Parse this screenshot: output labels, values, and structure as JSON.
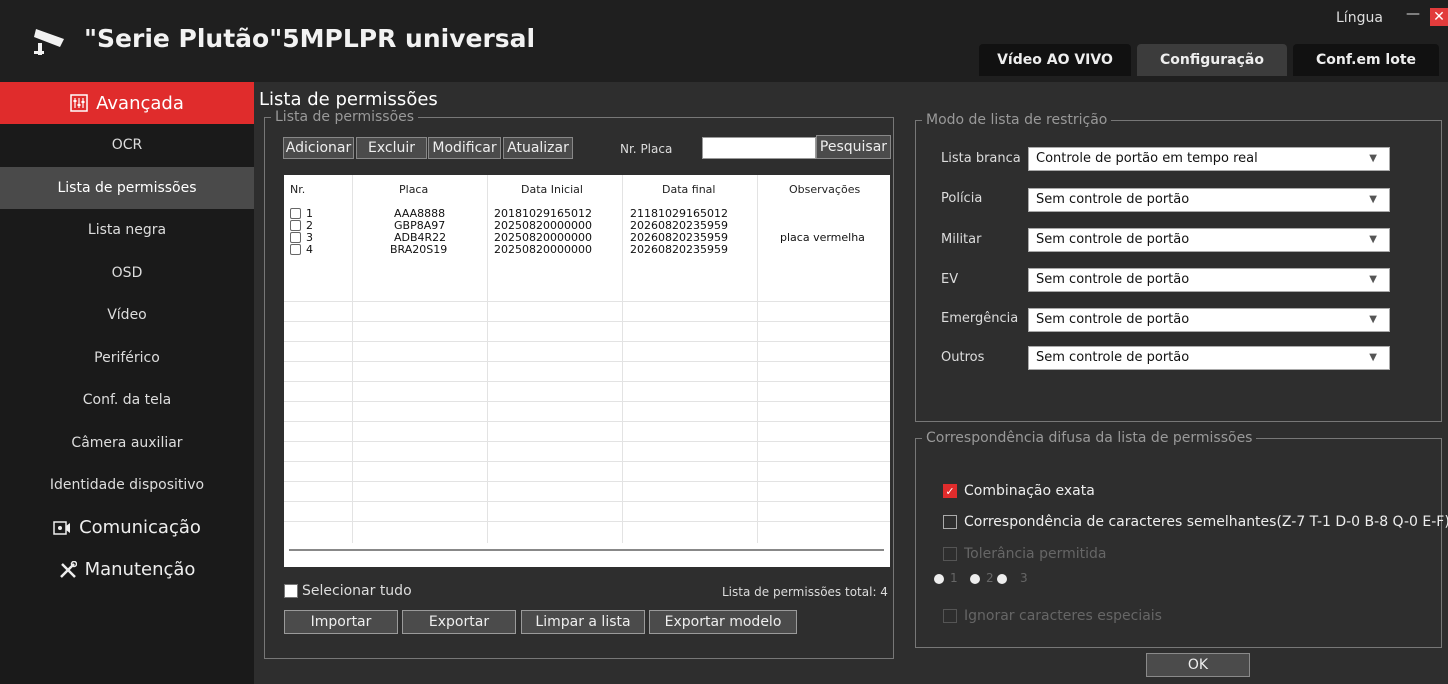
{
  "app": {
    "title": "\"Serie Plutão\"5MPLPR universal",
    "language_label": "Língua",
    "minimize": "—",
    "close": "✕"
  },
  "tabs": [
    "Vídeo AO VIVO",
    "Configuração",
    "Conf.em lote"
  ],
  "sidebar": {
    "header": "Avançada",
    "items": [
      "OCR",
      "Lista de permissões",
      "Lista negra",
      "OSD",
      "Vídeo",
      "Periférico",
      "Conf. da tela",
      "Câmera auxiliar",
      "Identidade dispositivo"
    ],
    "sections": [
      "Comunicação",
      "Manutenção"
    ]
  },
  "main": {
    "page_title": "Lista de permissões",
    "list_group": "Lista de permissões",
    "toolbar": {
      "add": "Adicionar",
      "delete": "Excluir",
      "modify": "Modificar",
      "refresh": "Atualizar",
      "plate_label": "Nr. Placa",
      "plate_value": "",
      "search": "Pesquisar"
    },
    "table": {
      "headers": [
        "Nr.",
        "Placa",
        "Data Inicial",
        "Data final",
        "Observações"
      ],
      "rows": [
        {
          "nr": "1",
          "placa": "AAA8888",
          "inicial": "20181029165012",
          "final": "21181029165012",
          "obs": ""
        },
        {
          "nr": "2",
          "placa": "GBP8A97",
          "inicial": "20250820000000",
          "final": "20260820235959",
          "obs": ""
        },
        {
          "nr": "3",
          "placa": "ADB4R22",
          "inicial": "20250820000000",
          "final": "20260820235959",
          "obs": "placa vermelha"
        },
        {
          "nr": "4",
          "placa": "BRA20S19",
          "inicial": "20250820000000",
          "final": "20260820235959",
          "obs": ""
        }
      ]
    },
    "select_all": "Selecionar tudo",
    "total": "Lista de permissões total: 4",
    "bottom_buttons": {
      "import": "Importar",
      "export": "Exportar",
      "clear": "Limpar a lista",
      "export_template": "Exportar modelo"
    }
  },
  "restriction": {
    "legend": "Modo de lista de restrição",
    "rows": [
      {
        "label": "Lista branca",
        "value": "Controle de portão em tempo real"
      },
      {
        "label": "Polícia",
        "value": "Sem controle de portão"
      },
      {
        "label": "Militar",
        "value": "Sem controle de portão"
      },
      {
        "label": "EV",
        "value": "Sem controle de portão"
      },
      {
        "label": "Emergência",
        "value": "Sem controle de portão"
      },
      {
        "label": "Outros",
        "value": "Sem controle de portão"
      }
    ]
  },
  "fuzzy": {
    "legend": "Correspondência difusa da lista de permissões",
    "exact": "Combinação exata",
    "similar": "Correspondência de caracteres semelhantes(Z-7 T-1 D-0 B-8 Q-0 E-F)",
    "tolerance": "Tolerância permitida",
    "radio_options": [
      "1",
      "2",
      "3"
    ],
    "ignore_special": "Ignorar caracteres especiais"
  },
  "ok": "OK",
  "colors": {
    "accent": "#e02c2c",
    "sidebar_bg": "#1a1a1a",
    "main_bg": "#2e2e2e"
  }
}
